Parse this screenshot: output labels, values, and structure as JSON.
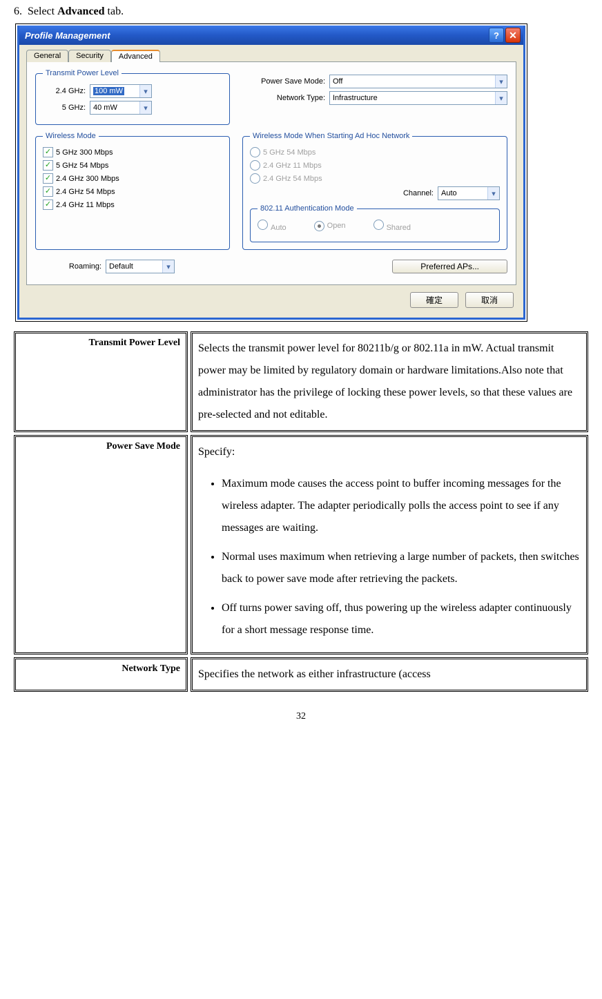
{
  "step": {
    "num": "6.",
    "prefix": "Select ",
    "bold": "Advanced",
    "suffix": " tab."
  },
  "dlg": {
    "title": "Profile Management",
    "tabs": {
      "general": "General",
      "security": "Security",
      "advanced": "Advanced"
    },
    "tpl": {
      "legend": "Transmit Power Level",
      "r1lbl": "2.4 GHz:",
      "r1val": "100 mW",
      "r2lbl": "5 GHz:",
      "r2val": "40 mW"
    },
    "psmLbl": "Power Save Mode:",
    "psmVal": "Off",
    "ntLbl": "Network Type:",
    "ntVal": "Infrastructure",
    "wm": {
      "legend": "Wireless Mode",
      "o1": "5 GHz 300 Mbps",
      "o2": "5 GHz 54 Mbps",
      "o3": "2.4 GHz 300 Mbps",
      "o4": "2.4 GHz 54 Mbps",
      "o5": "2.4 GHz 11 Mbps"
    },
    "wmad": {
      "legend": "Wireless Mode When Starting Ad Hoc Network",
      "o1": "5 GHz 54 Mbps",
      "o2": "2.4 GHz 11 Mbps",
      "o3": "2.4 GHz 54 Mbps",
      "chLbl": "Channel:",
      "chVal": "Auto"
    },
    "auth": {
      "legend": "802.11 Authentication Mode",
      "o1": "Auto",
      "o2": "Open",
      "o3": "Shared"
    },
    "roamLbl": "Roaming:",
    "roamVal": "Default",
    "prefBtn": "Preferred APs...",
    "ok": "確定",
    "cancel": "取消"
  },
  "table": {
    "r1k": "Transmit Power Level",
    "r1v": "Selects the transmit power level for 80211b/g or 802.11a in mW. Actual transmit power may be limited by regulatory domain or hardware limitations.Also note that administrator has the privilege of locking these power levels, so that these values are pre-selected and not editable.",
    "r2k": "Power Save Mode",
    "r2intro": "Specify:",
    "r2b1": "Maximum mode causes the   access point to buffer incoming messages for the wireless adapter.   The adapter periodically polls the access point to see if any messages are waiting.",
    "r2b2": "Normal uses maximum when retrieving a large number of packets, then switches back to power save mode after retrieving the packets.",
    "r2b3": "Off turns power saving off, thus powering up the wireless adapter continuously for a short message response time.",
    "r3k": "Network Type",
    "r3v": "Specifies the network as either infrastructure (access"
  },
  "pagenum": "32"
}
